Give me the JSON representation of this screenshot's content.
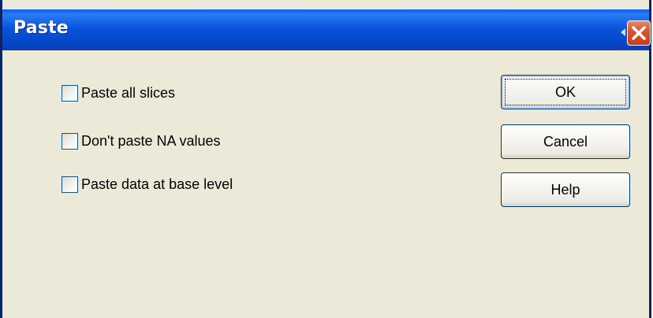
{
  "window": {
    "title": "Paste"
  },
  "titlebar": {
    "close_icon": "close-icon"
  },
  "options": [
    {
      "label": "Paste all slices",
      "checked": false
    },
    {
      "label": "Don't paste NA values",
      "checked": false
    },
    {
      "label": "Paste data at base level",
      "checked": false
    }
  ],
  "buttons": {
    "ok": "OK",
    "cancel": "Cancel",
    "help": "Help"
  },
  "colors": {
    "titlebar": "#0a55dc",
    "dialog_bg": "#ece9d8",
    "close_button": "#d9552e"
  }
}
